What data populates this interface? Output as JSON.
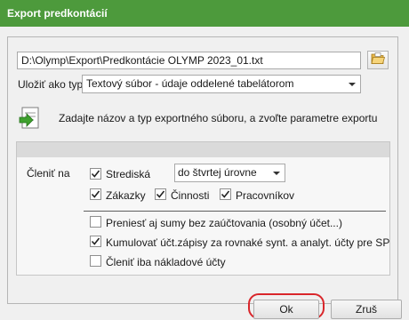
{
  "window": {
    "title": "Export predkontácií"
  },
  "file": {
    "path": "D:\\Olymp\\Export\\Predkontácie OLYMP 2023_01.txt",
    "browse_icon": "folder-open-icon"
  },
  "save_as": {
    "label": "Uložiť ako typ",
    "value": "Textový súbor - údaje oddelené tabelátorom"
  },
  "info": {
    "icon": "export-document-icon",
    "text": "Zadajte názov a typ exportného súboru, a zvoľte parametre exportu"
  },
  "options": {
    "split_label": "Členiť na",
    "strediska": {
      "label": "Strediská",
      "checked": true,
      "level_value": "do štvrtej úrovne"
    },
    "zakazky": {
      "label": "Zákazky",
      "checked": true
    },
    "cinnosti": {
      "label": "Činnosti",
      "checked": true
    },
    "pracovnikov": {
      "label": "Pracovníkov",
      "checked": true
    },
    "preniest": {
      "label": "Preniesť aj sumy bez zaúčtovania (osobný účet...)",
      "checked": false
    },
    "kumulovat": {
      "label": "Kumulovať účt.zápisy za rovnaké synt. a analyt. účty pre SP",
      "checked": true
    },
    "clenit_naklad": {
      "label": "Členiť iba nákladové účty",
      "checked": false
    }
  },
  "buttons": {
    "ok": "Ok",
    "cancel": "Zruš"
  },
  "colors": {
    "titlebar": "#4d9a3c",
    "highlight_ring": "#d9262b"
  }
}
